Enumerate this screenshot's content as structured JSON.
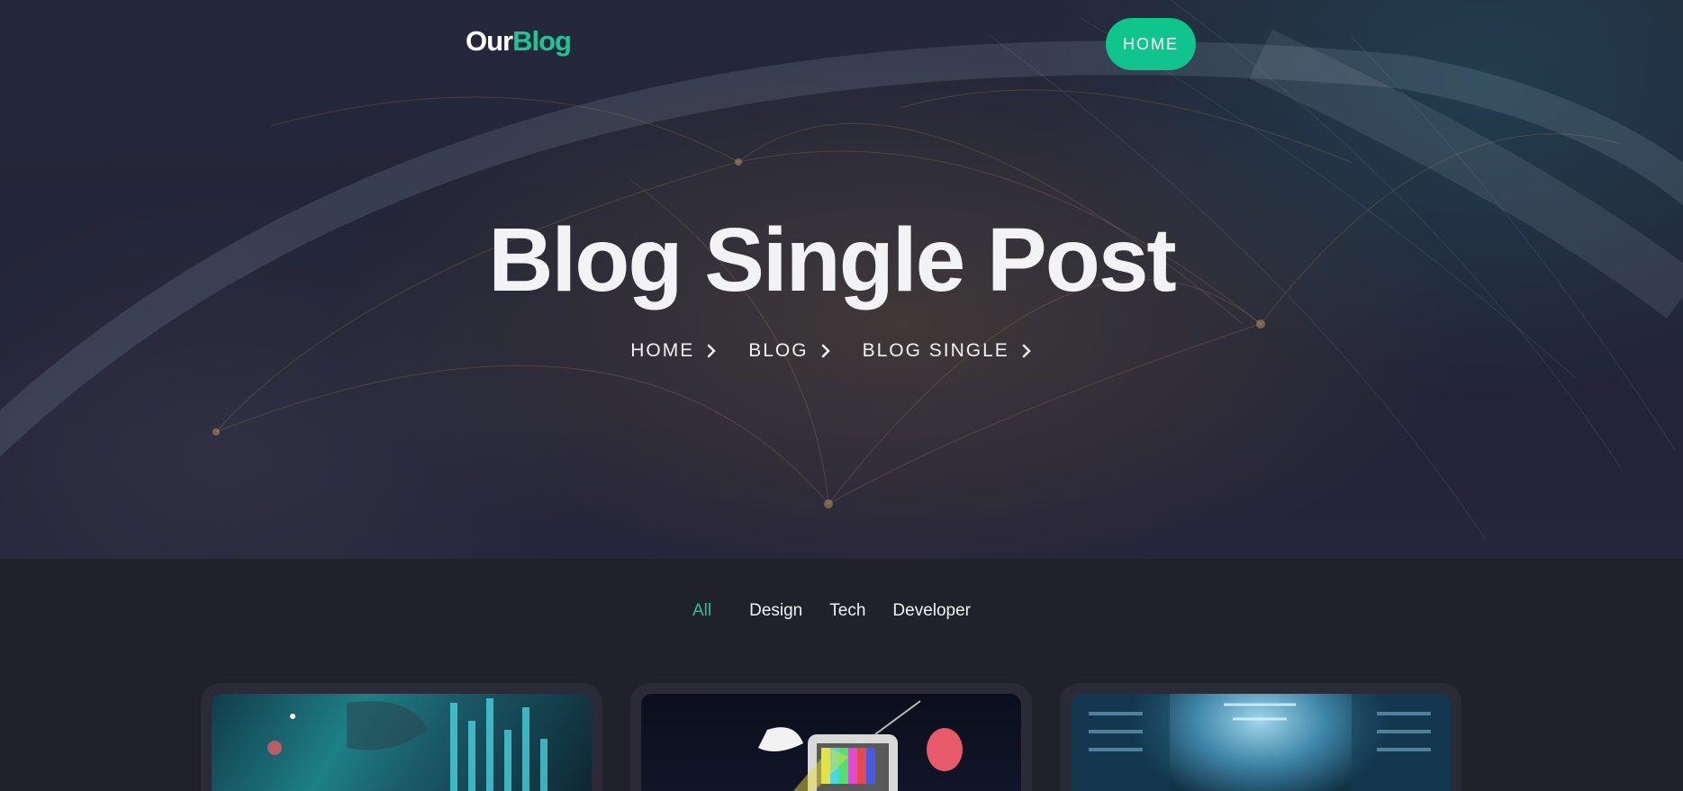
{
  "header": {
    "logo_part1": "Our",
    "logo_part2": "Blog",
    "nav_home": "HOME"
  },
  "hero": {
    "title": "Blog Single Post",
    "breadcrumb": [
      "HOME",
      "BLOG",
      "BLOG SINGLE"
    ]
  },
  "filters": {
    "items": [
      "All",
      "Design",
      "Tech",
      "Developer"
    ],
    "active": "All"
  },
  "cards": [
    {
      "image": "data-world-map-image"
    },
    {
      "image": "retro-tv-collage-image"
    },
    {
      "image": "server-room-image"
    }
  ],
  "colors": {
    "accent": "#1dc795",
    "button": "#0fc58c",
    "background": "#20212b",
    "card": "#2a2b37"
  }
}
